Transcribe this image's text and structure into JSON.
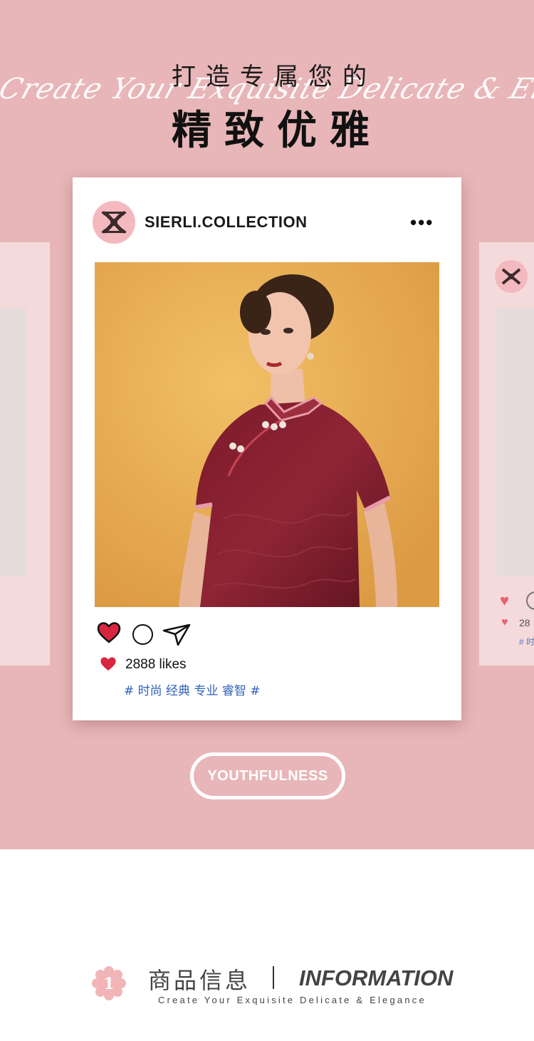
{
  "header": {
    "script_text": "Create Your Exquisite Delicate & Elegance",
    "title_small": "打造专属您的",
    "title_big": "精致优雅"
  },
  "post": {
    "account_name": "SIERLI.COLLECTION",
    "more_label": "•••",
    "likes": "2888 likes",
    "hashtags": "# 时尚 经典 专业 睿智 #"
  },
  "side_card": {
    "likes_partial": "28",
    "tag_partial": "# 时"
  },
  "cta": {
    "label": "YOUTHFULNESS"
  },
  "section": {
    "badge_number": "1",
    "title_cn": "商品信息",
    "title_en": "INFORMATION",
    "subtitle": "Create Your Exquisite Delicate & Elegance"
  },
  "colors": {
    "pink_background": "#e8b6b8",
    "avatar_pink": "#f3b9be",
    "heart_red": "#d8263f",
    "hashtag_blue": "#2f62b8"
  }
}
